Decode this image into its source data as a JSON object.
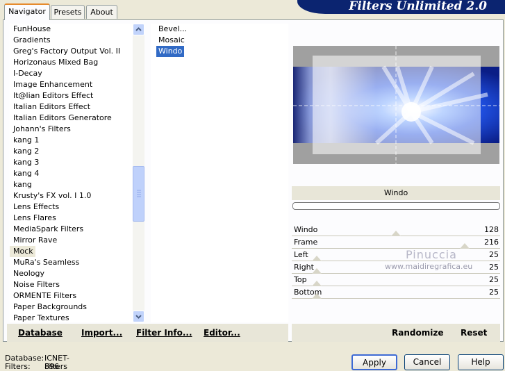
{
  "app_title": "Filters Unlimited 2.0",
  "tabs": [
    {
      "label": "Navigator"
    },
    {
      "label": "Presets"
    },
    {
      "label": "About"
    }
  ],
  "categories": [
    "FunHouse",
    "Gradients",
    "Greg's Factory Output Vol. II",
    "Horizonaus Mixed Bag",
    "I-Decay",
    "Image Enhancement",
    "It@lian Editors Effect",
    "Italian Editors Effect",
    "Italian Editors Generatore",
    "Johann's Filters",
    "kang 1",
    "kang 2",
    "kang 3",
    "kang 4",
    "kang",
    "Krusty's FX vol. I 1.0",
    "Lens Effects",
    "Lens Flares",
    "MediaSpark Filters",
    "Mirror Rave",
    "Mock",
    "MuRa's Seamless",
    "Neology",
    "Noise Filters",
    "ORMENTE Filters",
    "Paper Backgrounds",
    "Paper Textures"
  ],
  "selected_category": "Mock",
  "filters": [
    "Bevel...",
    "Mosaic",
    "Windo"
  ],
  "selected_filter": "Windo",
  "filter_name": "Windo",
  "params": [
    {
      "label": "Windo",
      "value": "128",
      "level": 0.5
    },
    {
      "label": "Frame",
      "value": "216",
      "level": 0.85
    },
    {
      "label": "Left",
      "value": "25",
      "level": 0.1
    },
    {
      "label": "Right",
      "value": "25",
      "level": 0.1
    },
    {
      "label": "Top",
      "value": "25",
      "level": 0.1
    },
    {
      "label": "Bottom",
      "value": "25",
      "level": 0.1
    }
  ],
  "watermark": {
    "line1": "Pinuccia",
    "line2": "www.maidiregrafica.eu"
  },
  "buttons": {
    "database": "Database",
    "import": "Import...",
    "filter_info": "Filter Info...",
    "editor": "Editor...",
    "randomize": "Randomize",
    "reset": "Reset",
    "apply": "Apply",
    "cancel": "Cancel",
    "help": "Help"
  },
  "status": {
    "database_label": "Database:",
    "database_value": "ICNET-Filters",
    "filters_label": "Filters:",
    "filters_value": "896"
  },
  "colors": {
    "selection": "#316ac5",
    "banner": "#0b2470",
    "accent_tab": "#e68b2c"
  }
}
